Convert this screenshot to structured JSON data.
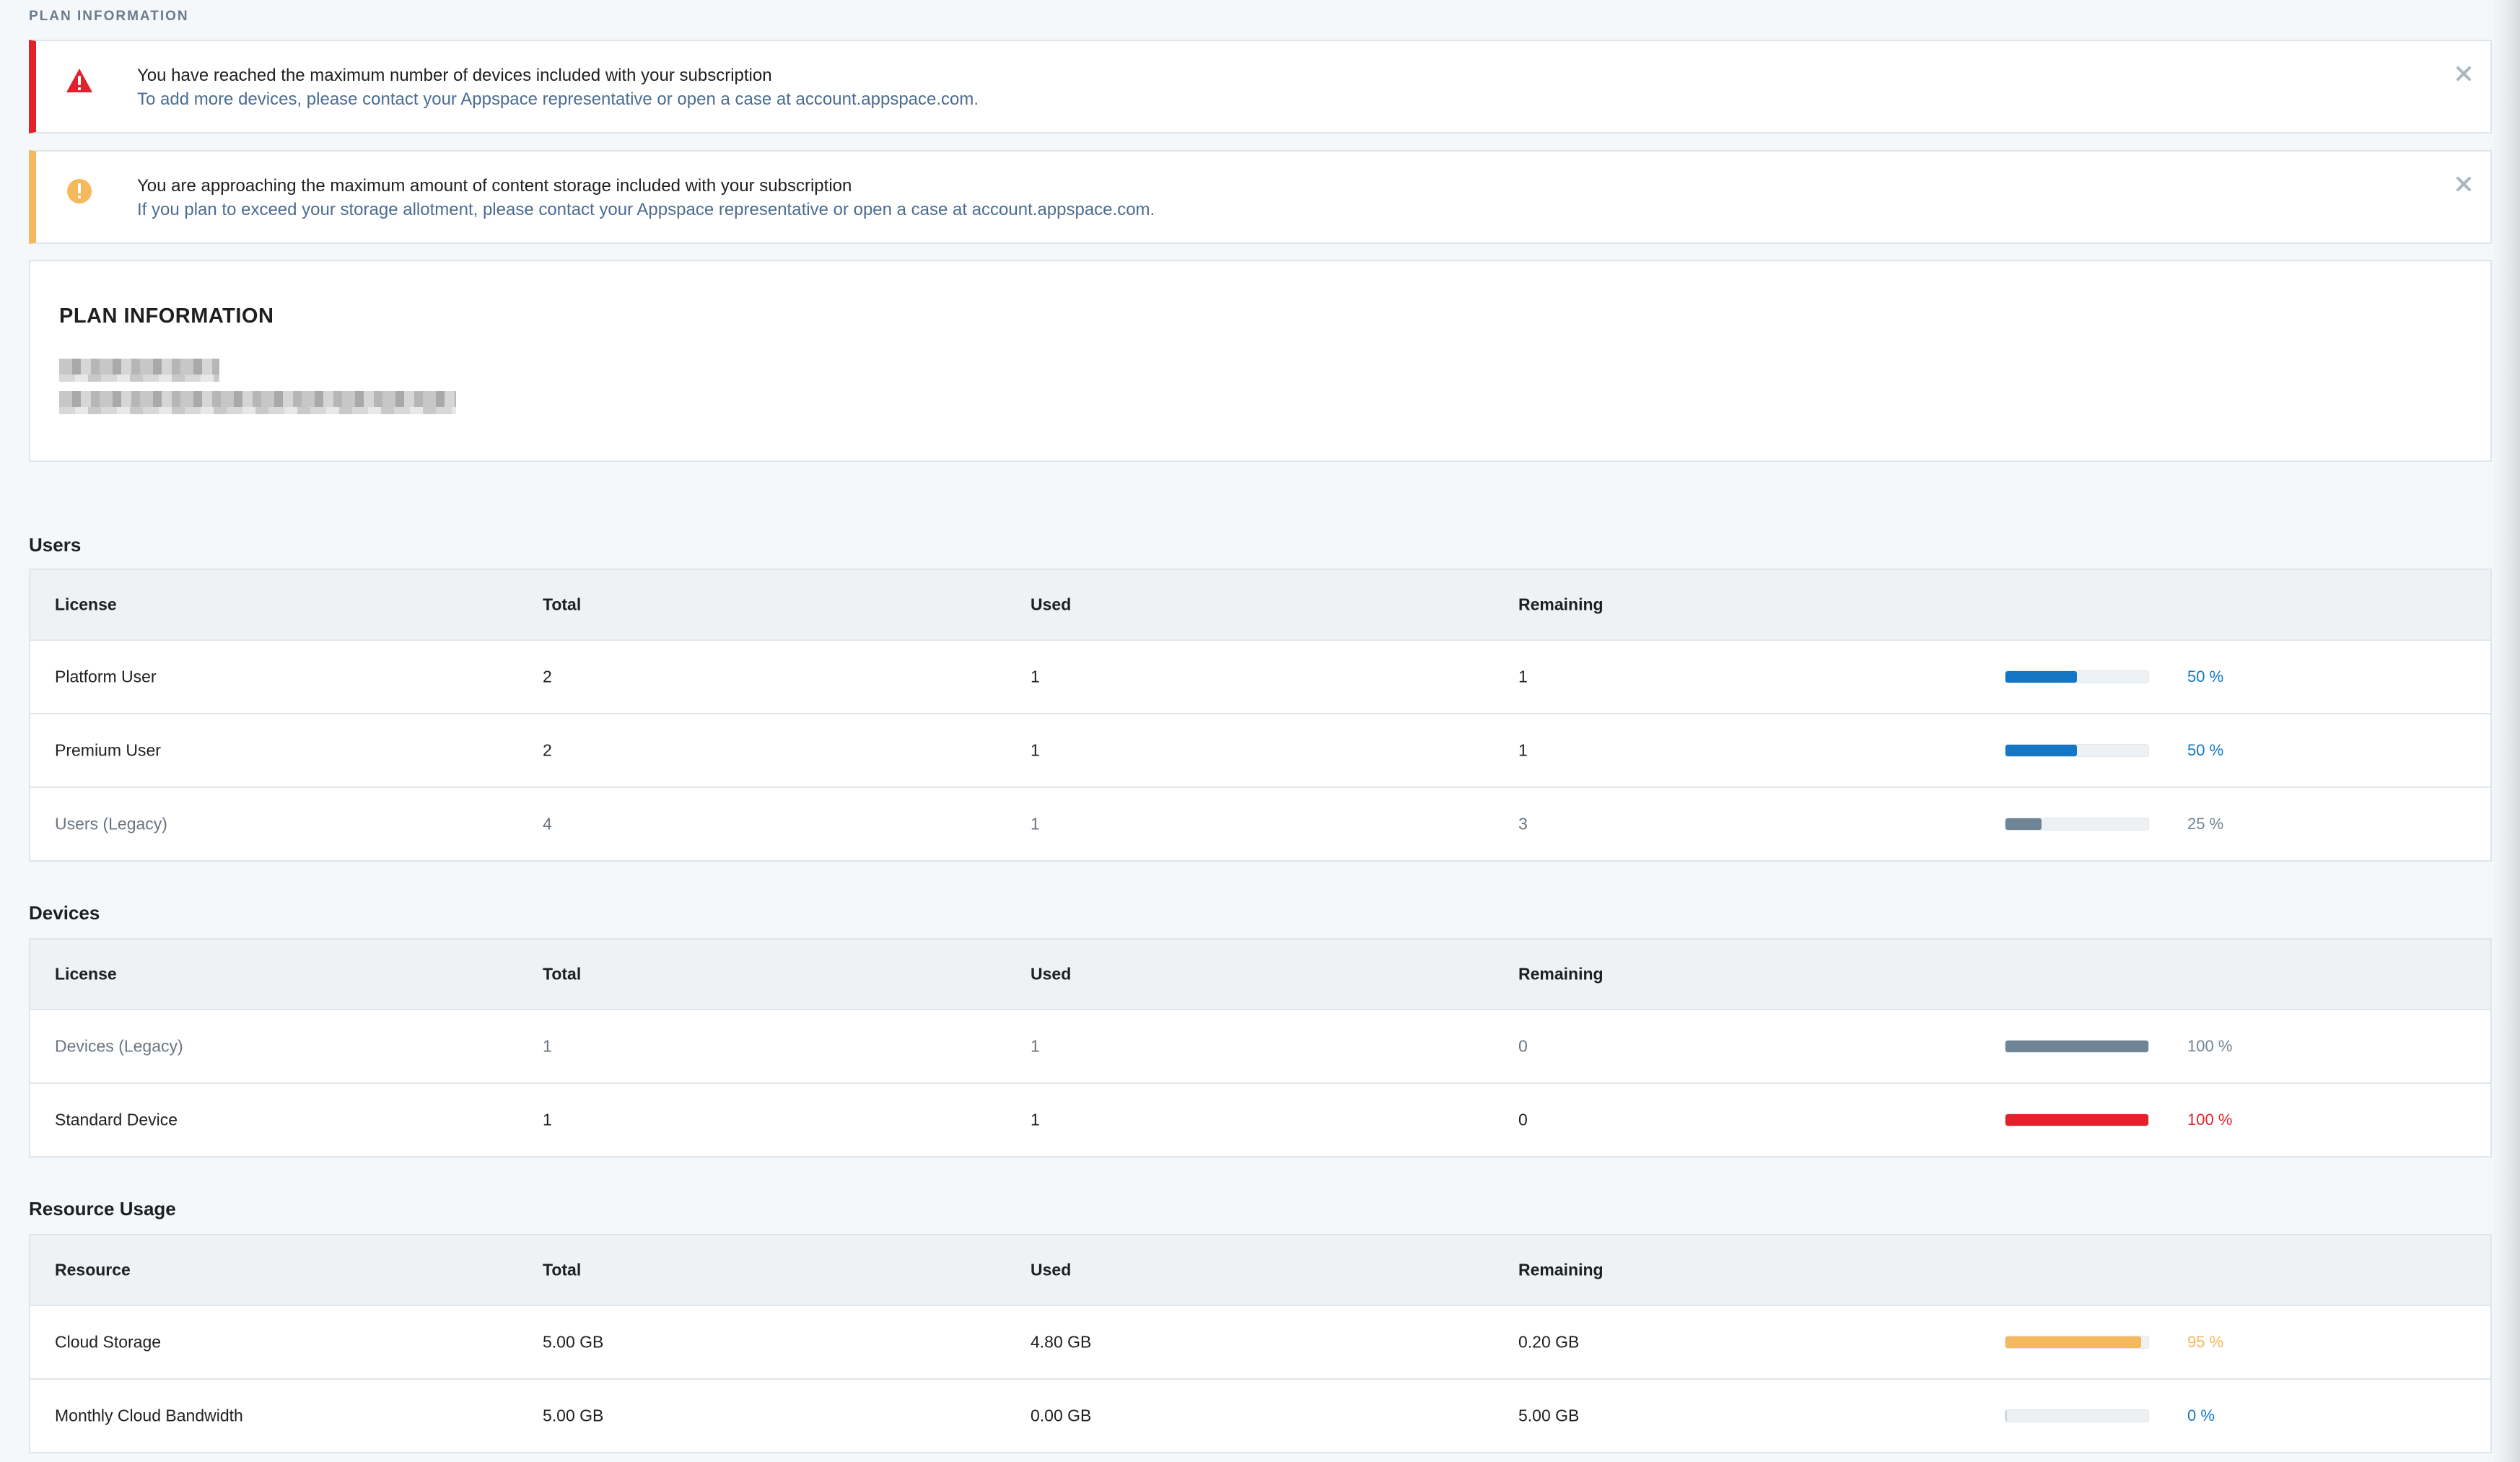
{
  "page": {
    "section_label": "PLAN INFORMATION"
  },
  "alerts": [
    {
      "type": "error",
      "icon": "warning-triangle-icon",
      "title": "You have reached the maximum number of devices included with your subscription",
      "message": "To add more devices, please contact your Appspace representative or open a case at account.appspace.com.",
      "color": "#e3212a"
    },
    {
      "type": "warning",
      "icon": "exclamation-circle-icon",
      "title": "You are approaching the maximum amount of content storage included with your subscription",
      "message": "If you plan to exceed your storage allotment, please contact your Appspace representative or open a case at account.appspace.com.",
      "color": "#f5b85c"
    }
  ],
  "plan": {
    "title": "PLAN INFORMATION"
  },
  "users": {
    "title": "Users",
    "headers": [
      "License",
      "Total",
      "Used",
      "Remaining"
    ],
    "rows": [
      {
        "name": "Platform User",
        "total": "2",
        "used": "1",
        "remaining": "1",
        "percent_label": "50 %",
        "percent": 50,
        "color": "#1477c6",
        "legacy": false
      },
      {
        "name": "Premium User",
        "total": "2",
        "used": "1",
        "remaining": "1",
        "percent_label": "50 %",
        "percent": 50,
        "color": "#1477c6",
        "legacy": false
      },
      {
        "name": "Users (Legacy)",
        "total": "4",
        "used": "1",
        "remaining": "3",
        "percent_label": "25 %",
        "percent": 25,
        "color": "#6f8494",
        "legacy": true
      }
    ]
  },
  "devices": {
    "title": "Devices",
    "headers": [
      "License",
      "Total",
      "Used",
      "Remaining"
    ],
    "rows": [
      {
        "name": "Devices (Legacy)",
        "total": "1",
        "used": "1",
        "remaining": "0",
        "percent_label": "100 %",
        "percent": 100,
        "color": "#6f8494",
        "legacy": true
      },
      {
        "name": "Standard Device",
        "total": "1",
        "used": "1",
        "remaining": "0",
        "percent_label": "100 %",
        "percent": 100,
        "color": "#e3212a",
        "legacy": false
      }
    ]
  },
  "resources": {
    "title": "Resource Usage",
    "headers": [
      "Resource",
      "Total",
      "Used",
      "Remaining"
    ],
    "rows": [
      {
        "name": "Cloud Storage",
        "total": "5.00 GB",
        "used": "4.80 GB",
        "remaining": "0.20 GB",
        "percent_label": "95 %",
        "percent": 95,
        "color": "#f5b85c",
        "legacy": false
      },
      {
        "name": "Monthly Cloud Bandwidth",
        "total": "5.00 GB",
        "used": "0.00 GB",
        "remaining": "5.00 GB",
        "percent_label": "0 %",
        "percent": 0,
        "color": "#1477c6",
        "legacy": false
      }
    ]
  },
  "colors": {
    "blue": "#1477c6",
    "legacy": "#6f8494",
    "red": "#e3212a",
    "orange": "#f5b85c",
    "link_text": "#4a6d92"
  }
}
